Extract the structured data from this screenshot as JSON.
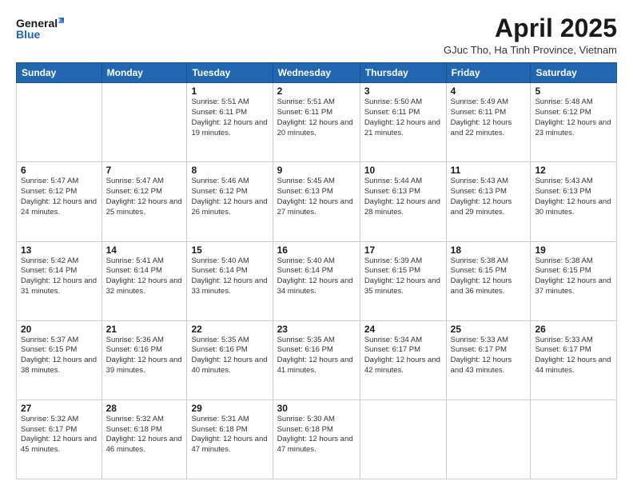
{
  "logo": {
    "line1": "General",
    "line2": "Blue"
  },
  "title": "April 2025",
  "subtitle": "GJuc Tho, Ha Tinh Province, Vietnam",
  "weekdays": [
    "Sunday",
    "Monday",
    "Tuesday",
    "Wednesday",
    "Thursday",
    "Friday",
    "Saturday"
  ],
  "weeks": [
    [
      {
        "day": "",
        "info": ""
      },
      {
        "day": "",
        "info": ""
      },
      {
        "day": "1",
        "info": "Sunrise: 5:51 AM\nSunset: 6:11 PM\nDaylight: 12 hours and 19 minutes."
      },
      {
        "day": "2",
        "info": "Sunrise: 5:51 AM\nSunset: 6:11 PM\nDaylight: 12 hours and 20 minutes."
      },
      {
        "day": "3",
        "info": "Sunrise: 5:50 AM\nSunset: 6:11 PM\nDaylight: 12 hours and 21 minutes."
      },
      {
        "day": "4",
        "info": "Sunrise: 5:49 AM\nSunset: 6:11 PM\nDaylight: 12 hours and 22 minutes."
      },
      {
        "day": "5",
        "info": "Sunrise: 5:48 AM\nSunset: 6:12 PM\nDaylight: 12 hours and 23 minutes."
      }
    ],
    [
      {
        "day": "6",
        "info": "Sunrise: 5:47 AM\nSunset: 6:12 PM\nDaylight: 12 hours and 24 minutes."
      },
      {
        "day": "7",
        "info": "Sunrise: 5:47 AM\nSunset: 6:12 PM\nDaylight: 12 hours and 25 minutes."
      },
      {
        "day": "8",
        "info": "Sunrise: 5:46 AM\nSunset: 6:12 PM\nDaylight: 12 hours and 26 minutes."
      },
      {
        "day": "9",
        "info": "Sunrise: 5:45 AM\nSunset: 6:13 PM\nDaylight: 12 hours and 27 minutes."
      },
      {
        "day": "10",
        "info": "Sunrise: 5:44 AM\nSunset: 6:13 PM\nDaylight: 12 hours and 28 minutes."
      },
      {
        "day": "11",
        "info": "Sunrise: 5:43 AM\nSunset: 6:13 PM\nDaylight: 12 hours and 29 minutes."
      },
      {
        "day": "12",
        "info": "Sunrise: 5:43 AM\nSunset: 6:13 PM\nDaylight: 12 hours and 30 minutes."
      }
    ],
    [
      {
        "day": "13",
        "info": "Sunrise: 5:42 AM\nSunset: 6:14 PM\nDaylight: 12 hours and 31 minutes."
      },
      {
        "day": "14",
        "info": "Sunrise: 5:41 AM\nSunset: 6:14 PM\nDaylight: 12 hours and 32 minutes."
      },
      {
        "day": "15",
        "info": "Sunrise: 5:40 AM\nSunset: 6:14 PM\nDaylight: 12 hours and 33 minutes."
      },
      {
        "day": "16",
        "info": "Sunrise: 5:40 AM\nSunset: 6:14 PM\nDaylight: 12 hours and 34 minutes."
      },
      {
        "day": "17",
        "info": "Sunrise: 5:39 AM\nSunset: 6:15 PM\nDaylight: 12 hours and 35 minutes."
      },
      {
        "day": "18",
        "info": "Sunrise: 5:38 AM\nSunset: 6:15 PM\nDaylight: 12 hours and 36 minutes."
      },
      {
        "day": "19",
        "info": "Sunrise: 5:38 AM\nSunset: 6:15 PM\nDaylight: 12 hours and 37 minutes."
      }
    ],
    [
      {
        "day": "20",
        "info": "Sunrise: 5:37 AM\nSunset: 6:15 PM\nDaylight: 12 hours and 38 minutes."
      },
      {
        "day": "21",
        "info": "Sunrise: 5:36 AM\nSunset: 6:16 PM\nDaylight: 12 hours and 39 minutes."
      },
      {
        "day": "22",
        "info": "Sunrise: 5:35 AM\nSunset: 6:16 PM\nDaylight: 12 hours and 40 minutes."
      },
      {
        "day": "23",
        "info": "Sunrise: 5:35 AM\nSunset: 6:16 PM\nDaylight: 12 hours and 41 minutes."
      },
      {
        "day": "24",
        "info": "Sunrise: 5:34 AM\nSunset: 6:17 PM\nDaylight: 12 hours and 42 minutes."
      },
      {
        "day": "25",
        "info": "Sunrise: 5:33 AM\nSunset: 6:17 PM\nDaylight: 12 hours and 43 minutes."
      },
      {
        "day": "26",
        "info": "Sunrise: 5:33 AM\nSunset: 6:17 PM\nDaylight: 12 hours and 44 minutes."
      }
    ],
    [
      {
        "day": "27",
        "info": "Sunrise: 5:32 AM\nSunset: 6:17 PM\nDaylight: 12 hours and 45 minutes."
      },
      {
        "day": "28",
        "info": "Sunrise: 5:32 AM\nSunset: 6:18 PM\nDaylight: 12 hours and 46 minutes."
      },
      {
        "day": "29",
        "info": "Sunrise: 5:31 AM\nSunset: 6:18 PM\nDaylight: 12 hours and 47 minutes."
      },
      {
        "day": "30",
        "info": "Sunrise: 5:30 AM\nSunset: 6:18 PM\nDaylight: 12 hours and 47 minutes."
      },
      {
        "day": "",
        "info": ""
      },
      {
        "day": "",
        "info": ""
      },
      {
        "day": "",
        "info": ""
      }
    ]
  ]
}
